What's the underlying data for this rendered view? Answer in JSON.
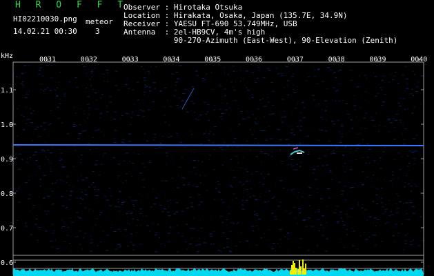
{
  "app": {
    "title": "H R O F F T"
  },
  "file": {
    "name": "HI02210030.png",
    "timestamp": "14.02.21 00:30"
  },
  "counter": {
    "label": "meteor",
    "value": "3"
  },
  "station": {
    "observer": "Observer : Hirotaka Otsuka",
    "location": "Location : Hirakata, Osaka, Japan (135.7E, 34.9N)",
    "receiver": "Receiver : YAESU FT-690 53.749MHz, USB",
    "antenna": "Antenna  : 2el-HB9CV, 4m's high",
    "antenna2": "           90-270-Azimuth (East-West), 90-Elevation (Zenith)"
  },
  "axis": {
    "unit": "kHz",
    "time_ticks": [
      "0031",
      "0032",
      "0033",
      "0034",
      "0035",
      "0036",
      "0037",
      "0038",
      "0039",
      "0040"
    ],
    "freq_ticks": [
      "1.1",
      "1.0",
      "0.9",
      "0.8",
      "0.7",
      "0.6"
    ]
  },
  "colors": {
    "background": "#000000",
    "title": "#2fd94a",
    "carrier": "#3a78ff",
    "noise_floor": "#00d8f0",
    "meteor_peak": "#f0f000",
    "grid": "#a0a0a0"
  }
}
